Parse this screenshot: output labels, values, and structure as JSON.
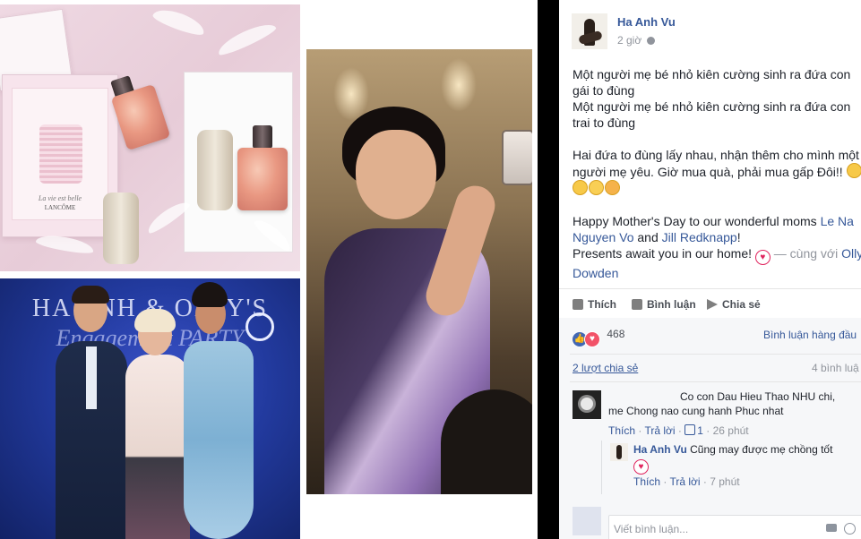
{
  "post": {
    "author": "Ha Anh Vu",
    "time": "2 giờ",
    "lines": [
      "Một người mẹ bé nhỏ kiên cường sinh ra đứa con",
      "gái to đùng",
      "Một người mẹ bé nhỏ kiên cường sinh ra đứa con",
      "trai to đùng"
    ],
    "lines2": [
      "Hai đứa to đùng lấy nhau, nhận thêm cho mình một",
      "người mẹ yêu. Giờ mua quà, phải mua gấp Đôi!!"
    ],
    "happy_prefix": "Happy Mother's Day to our wonderful moms ",
    "tag1": "Le Na",
    "tag1b": "Nguyen Vo",
    "and": " and ",
    "tag2": "Jill Redknapp",
    "excl": "!",
    "presents": "Presents await you in our home! ",
    "with": " — cùng với ",
    "tag3": "Olly",
    "tag3b": "Dowden"
  },
  "actions": {
    "like": "Thích",
    "comment": "Bình luận",
    "share": "Chia sẻ"
  },
  "stats": {
    "reactions": "468",
    "ranking": "Bình luận hàng đầu",
    "shares": "2 lượt chia sẻ",
    "comments": "4 bình luậ"
  },
  "comments": [
    {
      "text": "Co con Dau Hieu Thao NHU chi,",
      "text2": "me Chong nao cung hanh Phuc nhat",
      "like": "Thích",
      "reply": "Trả lời",
      "likes": "1",
      "time": "26 phút"
    },
    {
      "author": "Ha Anh Vu",
      "text": "Cũng may được mẹ chồng tốt",
      "like": "Thích",
      "reply": "Trả lời",
      "time": "7 phút"
    }
  ],
  "composer": {
    "placeholder": "Viết bình luận..."
  },
  "photos": {
    "perfume_script": "La vie est belle",
    "perfume_brand": "LANCÔME",
    "banner": "HA ANH & OLLY'S",
    "banner2": "Engagement PARTY"
  },
  "colors": {
    "link": "#365899",
    "muted": "#90949c",
    "text": "#1d2129",
    "like_blue": "#4267b2",
    "love_red": "#f25268"
  }
}
